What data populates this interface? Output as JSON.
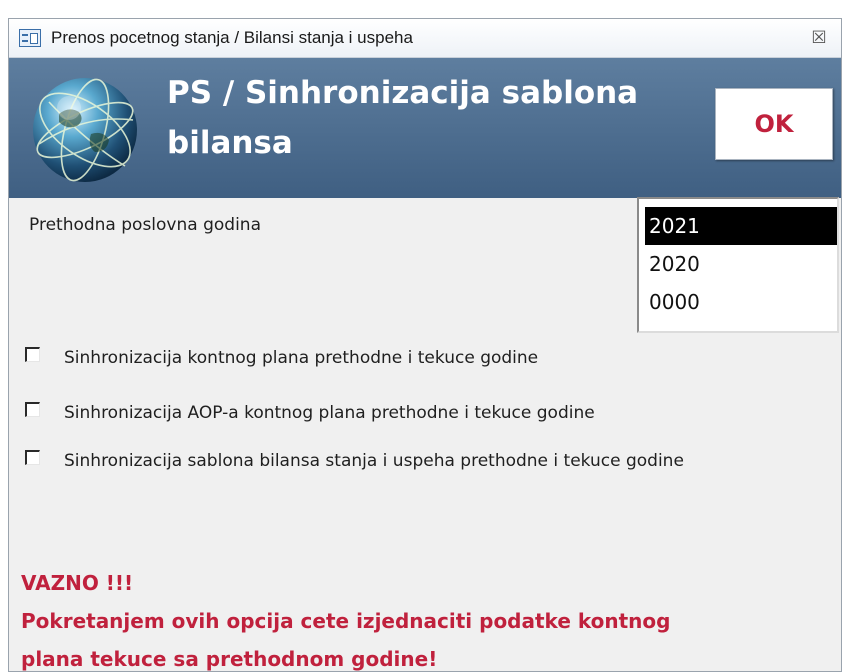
{
  "window": {
    "title": "Prenos pocetnog stanja / Bilansi stanja i uspeha",
    "close_glyph": "☒"
  },
  "header": {
    "title": "PS / Sinhronizacija sablona bilansa",
    "ok_label": "OK",
    "background": "#4a6b8f"
  },
  "year_field": {
    "label": "Prethodna poslovna godina",
    "options": [
      "2021",
      "2020",
      "0000"
    ],
    "selected": "2021"
  },
  "options": [
    {
      "label": "Sinhronizacija kontnog plana prethodne i tekuce godine",
      "checked": false
    },
    {
      "label": "Sinhronizacija AOP-a kontnog plana prethodne i  tekuce godine",
      "checked": false
    },
    {
      "label": "Sinhronizacija sablona bilansa stanja i uspeha  prethodne i  tekuce godine",
      "checked": false
    }
  ],
  "warning": {
    "heading": "VAZNO !!!",
    "line1": "Pokretanjem ovih opcija cete izjednaciti podatke kontnog",
    "line2": "plana tekuce sa prethodnom godine!",
    "color": "#c0213d"
  },
  "icons": [
    "form-icon",
    "close-icon",
    "globe-icon"
  ]
}
